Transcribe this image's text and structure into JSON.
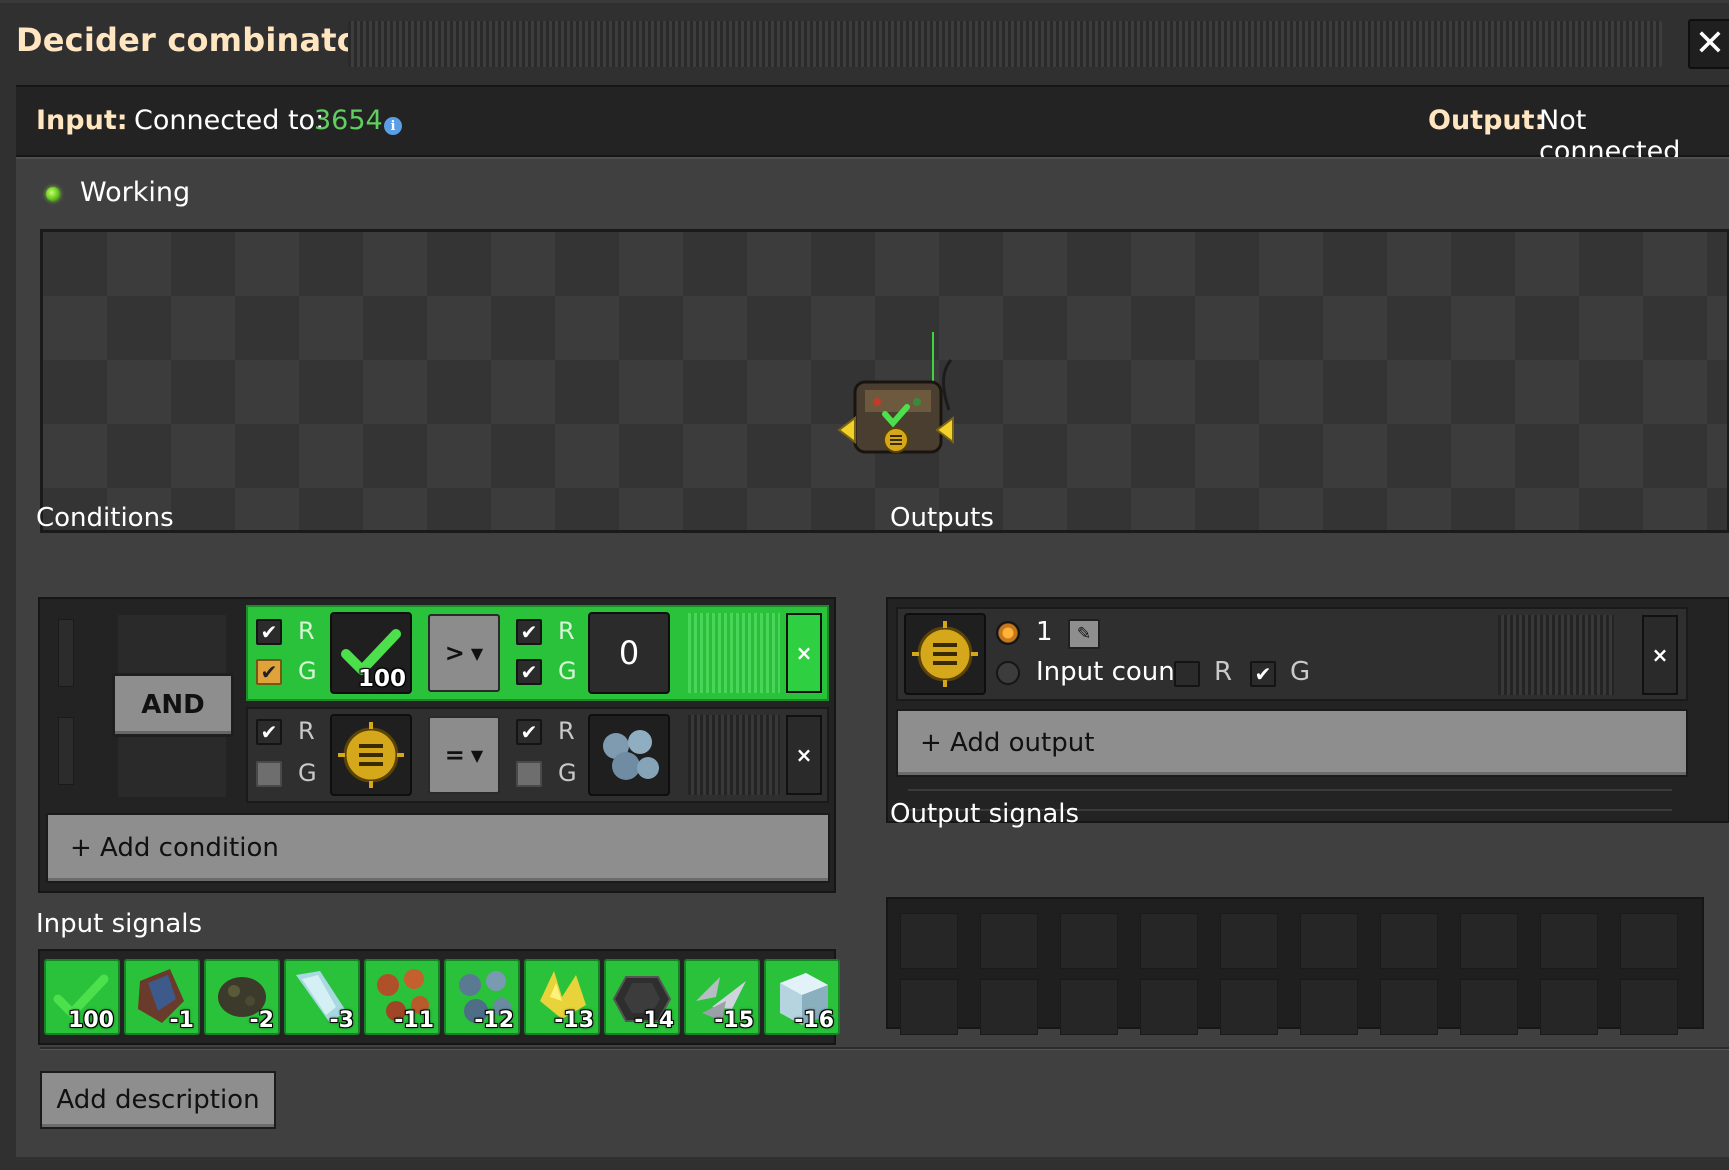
{
  "window": {
    "title": "Decider combinator",
    "close_icon": "close-icon"
  },
  "connection": {
    "input_label": "Input:",
    "input_text": "Connected to:",
    "input_network_id": "3654",
    "output_label": "Output:",
    "output_text": "Not connected"
  },
  "status": {
    "text": "Working",
    "color": "#5cbf1a"
  },
  "conditions": {
    "title": "Conditions",
    "combiner": "AND",
    "rows": [
      {
        "left_r": "R",
        "left_g": "G",
        "left_signal": "signal-check-icon",
        "left_count": "100",
        "operator": ">",
        "right_r": "R",
        "right_g": "G",
        "right_constant": "0",
        "highlighted": true
      },
      {
        "left_r": "R",
        "left_g": "G",
        "left_signal": "signal-each-icon",
        "operator": "=",
        "right_r": "R",
        "right_g": "G",
        "right_signal": "iron-ore-icon",
        "highlighted": false
      }
    ],
    "remove_label": "×",
    "add_label": "+ Add condition"
  },
  "outputs": {
    "title": "Outputs",
    "signal": "signal-each-icon",
    "value_option": "1",
    "input_count_option": "Input count",
    "r_label": "R",
    "g_label": "G",
    "remove_label": "×",
    "add_label": "+ Add output"
  },
  "output_signals": {
    "title": "Output signals"
  },
  "input_signals": {
    "title": "Input signals",
    "items": [
      {
        "icon": "signal-check-icon",
        "value": "100"
      },
      {
        "icon": "iron-ore-icon",
        "value": "-1"
      },
      {
        "icon": "coal-icon",
        "value": "-2"
      },
      {
        "icon": "ice-icon",
        "value": "-3"
      },
      {
        "icon": "copper-ore-icon",
        "value": "-11"
      },
      {
        "icon": "calcite-icon",
        "value": "-12"
      },
      {
        "icon": "sulfur-icon",
        "value": "-13"
      },
      {
        "icon": "stone-icon",
        "value": "-14"
      },
      {
        "icon": "tungsten-ore-icon",
        "value": "-15"
      },
      {
        "icon": "ice-block-icon",
        "value": "-16"
      }
    ]
  },
  "footer": {
    "add_description": "Add description"
  },
  "colors": {
    "accent_green": "#29c23a",
    "title": "#ffe6c0",
    "network_id": "#5fd05f"
  }
}
